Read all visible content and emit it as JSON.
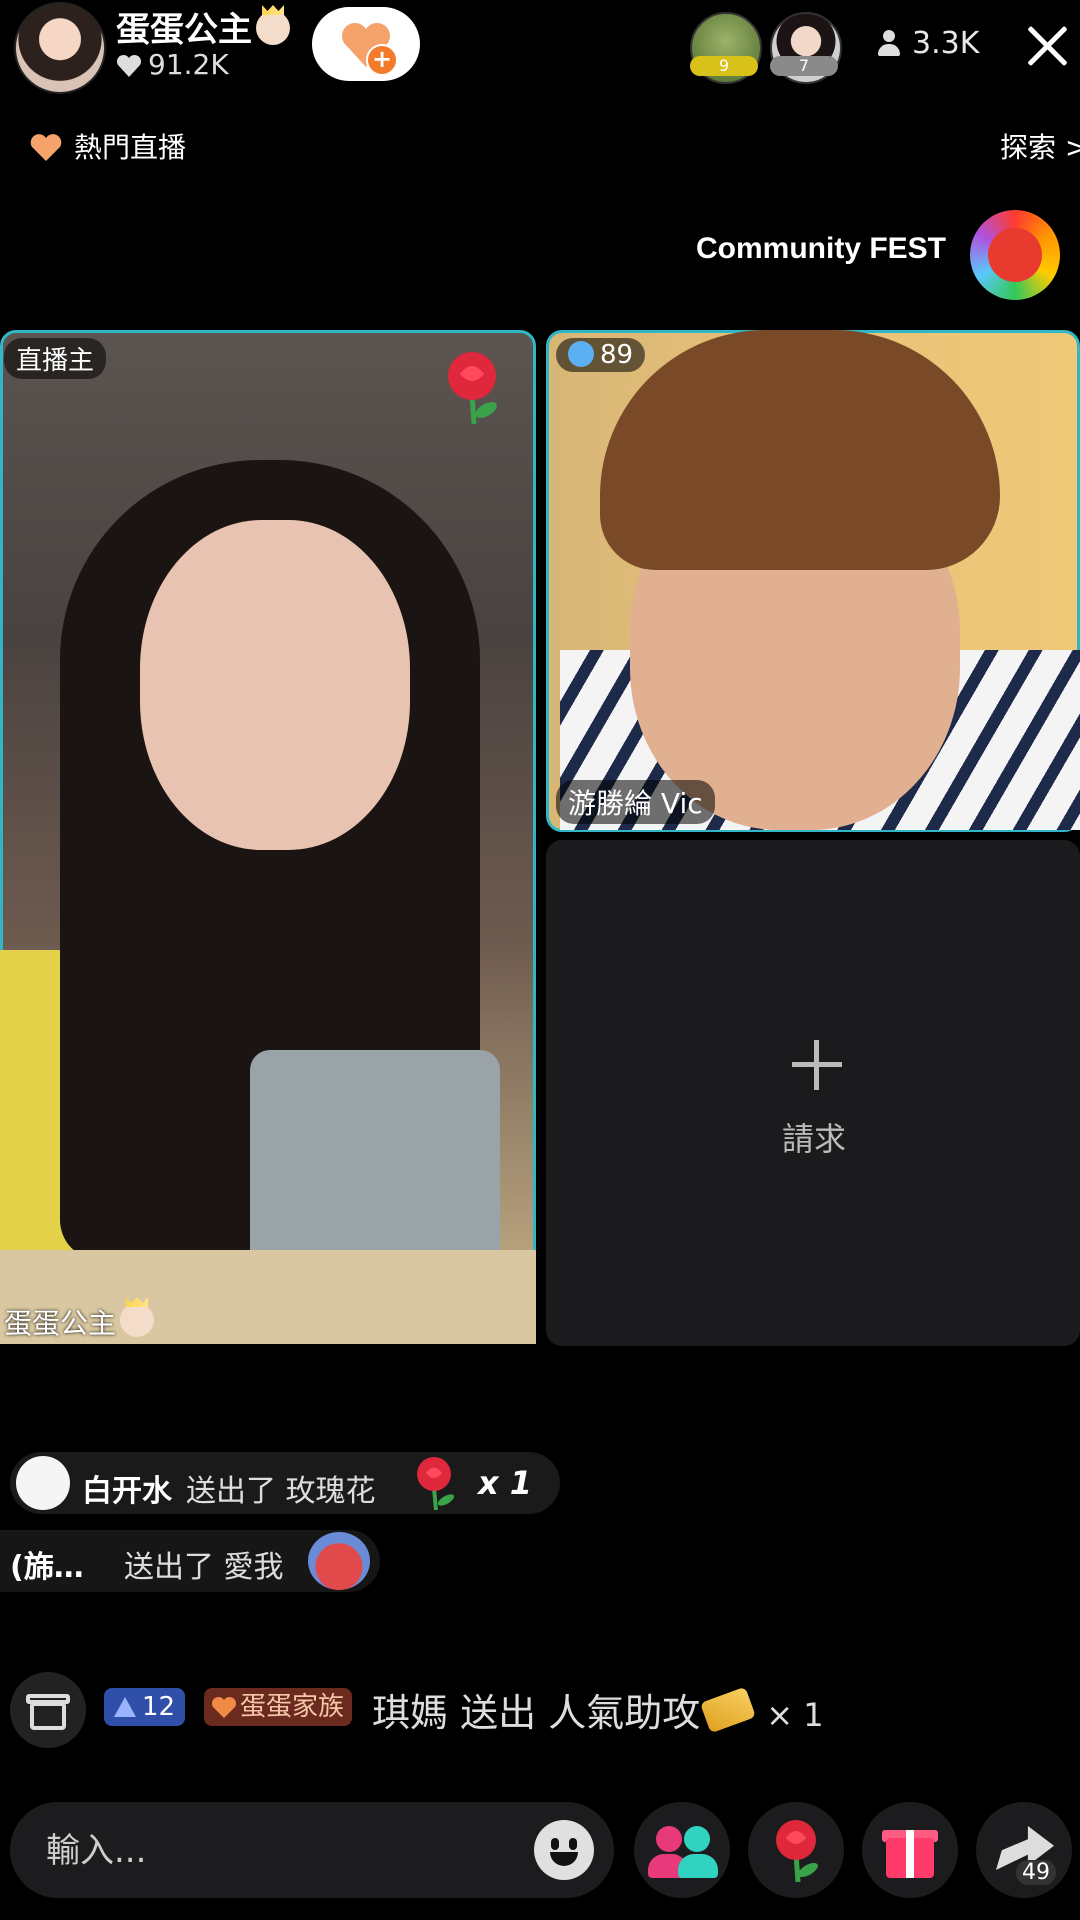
{
  "header": {
    "host_name": "蛋蛋公主",
    "host_likes": "91.2K",
    "viewers_count": "3.3K",
    "top_viewers": [
      {
        "rank": "9"
      },
      {
        "rank": "7"
      }
    ]
  },
  "subheader": {
    "hot_live": "熱門直播",
    "explore": "探索 >"
  },
  "event": {
    "label": "Community FEST"
  },
  "panels": {
    "host": {
      "role": "直播主",
      "name": "蛋蛋公主"
    },
    "guest": {
      "level": "89",
      "name": "游勝綸 Vic"
    },
    "request": {
      "label": "請求"
    }
  },
  "chat": {
    "gifts": [
      {
        "user": "白开水",
        "action": "送出了 玫瑰花",
        "count": "x 1"
      },
      {
        "user": "(旆…",
        "action": "送出了 愛我"
      }
    ],
    "system": {
      "level_badge": "12",
      "fan_badge": "蛋蛋家族",
      "user": "琪媽",
      "action": "送出 人氣助攻",
      "count": "× 1"
    }
  },
  "bottom_bar": {
    "input_placeholder": "輸入...",
    "share_count": "49"
  },
  "colors": {
    "panel_border": "#31b6c6",
    "accent_orange": "#f6a26b",
    "level_badge": "#2f4fa8"
  },
  "icons": [
    "heart-icon",
    "add-follow-icon",
    "person-icon",
    "close-icon",
    "rose-icon",
    "gift-box-icon",
    "emoji-icon",
    "multi-guest-icon",
    "gift-icon",
    "share-icon",
    "plus-icon"
  ]
}
